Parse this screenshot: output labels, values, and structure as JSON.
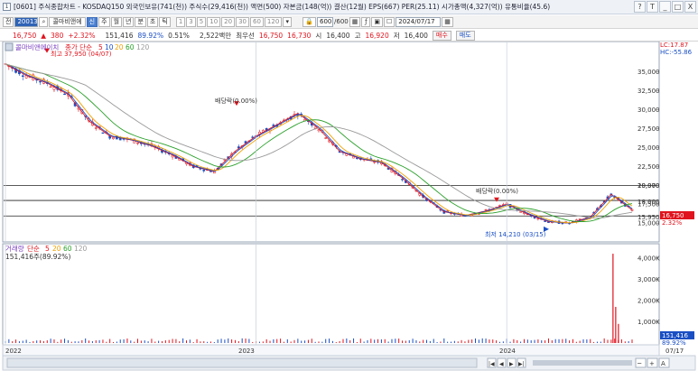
{
  "window": {
    "title": "[0601] 주식종합차트 - KOSDAQ150 외국인보유(741(천)) 주식수(29,416(천)) 액면(500) 자본금(148(억)) 결산(12월) EPS(667) PER(25.11) 시가총액(4,327(억)) 유통비율(45.6)",
    "icon": "1",
    "buttons": [
      "?",
      "T",
      "_",
      "□",
      "X"
    ]
  },
  "toolbar": {
    "dropdown_label": "전",
    "code_value": "200130",
    "search_icon": "search-icon",
    "stock_name": "콜마비앤에",
    "credit_badge": "신",
    "periods": [
      "주",
      "월",
      "년",
      "분",
      "초",
      "틱"
    ],
    "minutes": [
      "1",
      "3",
      "5",
      "10",
      "20",
      "30",
      "60",
      "120"
    ],
    "count_value": "600",
    "count_total": "/600",
    "date_value": "2024/07/17"
  },
  "quote": {
    "price": "16,750",
    "change_arrow": "▲",
    "change": "380",
    "change_pct": "+2.32%",
    "volume": "151,416",
    "vol_ratio": "89.92%",
    "turnover": "0.51%",
    "amount": "2,522백만",
    "pref_label": "최우선",
    "ask": "16,750",
    "bid": "16,730",
    "open_label": "시",
    "open": "16,400",
    "high_label": "고",
    "high": "16,920",
    "low_label": "저",
    "low": "16,400",
    "buy_button": "매수",
    "sell_button": "매도"
  },
  "chart_data": {
    "type": "line",
    "title": "콜마비앤에이치",
    "legend": [
      {
        "name": "종가 단순",
        "value": "5",
        "color": "#e0141e"
      },
      {
        "name": "",
        "value": "10",
        "color": "#1a4fc4"
      },
      {
        "name": "",
        "value": "20",
        "color": "#f0a000"
      },
      {
        "name": "",
        "value": "60",
        "color": "#2aa02a"
      },
      {
        "name": "",
        "value": "120",
        "color": "#9a9a9a"
      }
    ],
    "lc_label": "LC:17.87",
    "hc_label": "HC:-55.86",
    "ylim": [
      13000,
      38500
    ],
    "y_ticks": [
      15000,
      17500,
      20000,
      22500,
      25000,
      27500,
      30000,
      32500,
      35000
    ],
    "x_labels": [
      "2022",
      "2023",
      "2024",
      "07/17"
    ],
    "series": [
      {
        "name": "종가",
        "x": [
          "2022-01",
          "2022-02",
          "2022-03",
          "2022-04",
          "2022-05",
          "2022-06",
          "2022-07",
          "2022-08",
          "2022-09",
          "2022-10",
          "2022-11",
          "2022-12",
          "2023-01",
          "2023-02",
          "2023-03",
          "2023-04",
          "2023-05",
          "2023-06",
          "2023-07",
          "2023-08",
          "2023-09",
          "2023-10",
          "2023-11",
          "2023-12",
          "2024-01",
          "2024-02",
          "2024-03",
          "2024-04",
          "2024-05",
          "2024-06",
          "2024-07"
        ],
        "values": [
          36000,
          34500,
          33500,
          32000,
          28500,
          26500,
          26000,
          25200,
          24000,
          22500,
          21800,
          24500,
          26500,
          28000,
          29500,
          27500,
          24500,
          23500,
          23000,
          21000,
          18500,
          16500,
          16000,
          16600,
          17500,
          16200,
          15200,
          15000,
          15800,
          18800,
          16750
        ]
      }
    ],
    "annotations": [
      {
        "text": "최고 37,950 (04/07)",
        "value": 37950
      },
      {
        "text": "배당락(0.00%)",
        "value": 30500
      },
      {
        "text": "배당락(0.00%)",
        "value": 17800
      },
      {
        "text": "최저 14,210 (03/15)",
        "value": 14210
      }
    ],
    "hlines": [
      {
        "label": "19,970",
        "value": 19970
      },
      {
        "label": "18,000",
        "value": 18000
      },
      {
        "label": "15,950",
        "value": 15950
      }
    ],
    "price_tags": [
      {
        "label": "16,750",
        "value": 16750
      },
      {
        "label": "2.32%",
        "value": 16200
      }
    ],
    "volume_panel": {
      "title": "거래량",
      "legend": [
        {
          "name": "단순",
          "value": "5",
          "color": "#e0141e"
        },
        {
          "name": "",
          "value": "20",
          "color": "#f0a000"
        },
        {
          "name": "",
          "value": "60",
          "color": "#2aa02a"
        },
        {
          "name": "",
          "value": "120",
          "color": "#9a9a9a"
        }
      ],
      "current": "151,416주(89.92%)",
      "ylim": [
        0,
        4500000
      ],
      "y_tick_labels": [
        "4,000K",
        "3,000K",
        "2,000K",
        "1,000K"
      ],
      "y_ticks": [
        4000000,
        3000000,
        2000000,
        1000000
      ],
      "tag_value": "151,416",
      "tag_pct": "89.92%",
      "spikes": [
        {
          "month": "2024-06",
          "value": 4200000
        },
        {
          "month": "2024-06",
          "value": 1700000
        },
        {
          "month": "2024-06",
          "value": 900000
        }
      ]
    }
  },
  "scrollbar": {
    "nav_buttons": [
      "|◀",
      "◀",
      "▶",
      "▶|"
    ],
    "zoom_buttons": [
      "─",
      "+",
      "A"
    ]
  }
}
